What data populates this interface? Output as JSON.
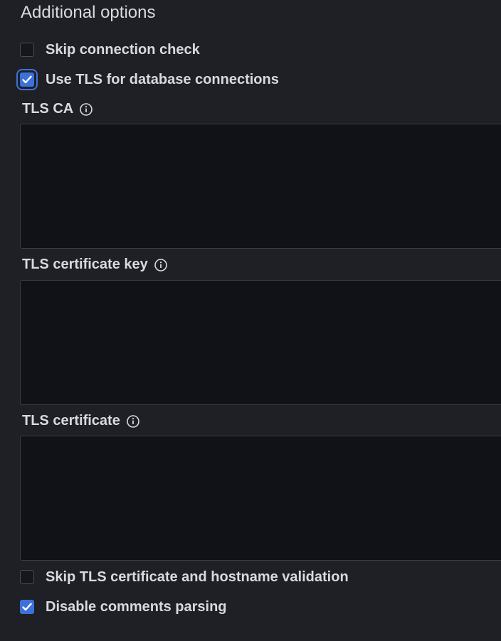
{
  "section": {
    "title": "Additional options"
  },
  "options": {
    "skip_connection_check": {
      "label": "Skip connection check",
      "checked": false
    },
    "use_tls": {
      "label": "Use TLS for database connections",
      "checked": true
    },
    "skip_tls_validation": {
      "label": "Skip TLS certificate and hostname validation",
      "checked": false
    },
    "disable_comments_parsing": {
      "label": "Disable comments parsing",
      "checked": true
    }
  },
  "fields": {
    "tls_ca": {
      "label": "TLS CA",
      "value": "",
      "icon": "info-icon"
    },
    "tls_cert_key": {
      "label": "TLS certificate key",
      "value": "",
      "icon": "info-icon"
    },
    "tls_cert": {
      "label": "TLS certificate",
      "value": "",
      "icon": "info-icon"
    }
  },
  "colors": {
    "background": "#1f2025",
    "input_background": "#111217",
    "accent": "#3d71d9",
    "text": "#d8dae0"
  }
}
